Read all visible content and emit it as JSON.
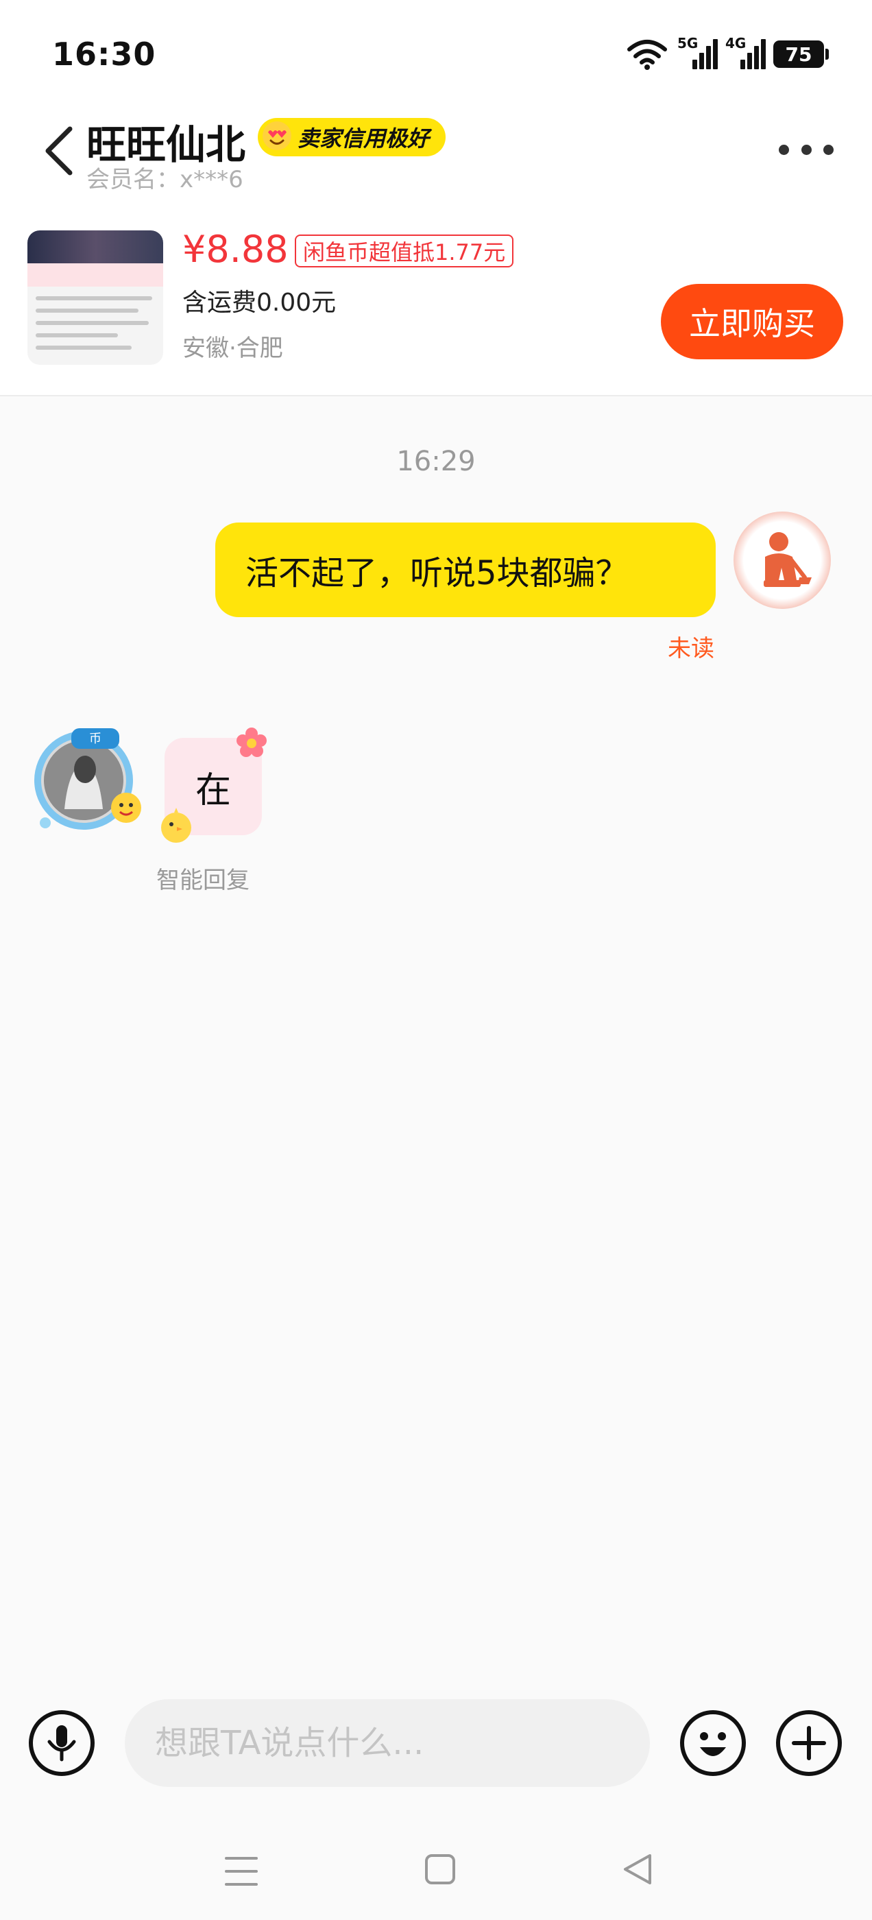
{
  "status_bar": {
    "time": "16:30",
    "network_1": "5G",
    "network_2": "4G",
    "battery": "75"
  },
  "header": {
    "seller_name": "旺旺仙北",
    "credit_badge": "卖家信用极好",
    "member_id": "会员名：x***6"
  },
  "product": {
    "price": "¥8.88",
    "coin_tag": "闲鱼币超值抵1.77元",
    "shipping": "含运费0.00元",
    "location": "安徽·合肥",
    "buy_label": "立即购买"
  },
  "chat": {
    "time": "16:29",
    "messages": [
      {
        "from": "self",
        "text": "活不起了，听说5块都骗？",
        "status": "未读"
      },
      {
        "from": "seller",
        "text": "在",
        "note": "智能回复"
      }
    ]
  },
  "input": {
    "placeholder": "想跟TA说点什么..."
  },
  "colors": {
    "accent_yellow": "#ffe40b",
    "buy_orange": "#ff4a10",
    "price_red": "#f2353a",
    "unread_orange": "#ff5a1f"
  }
}
